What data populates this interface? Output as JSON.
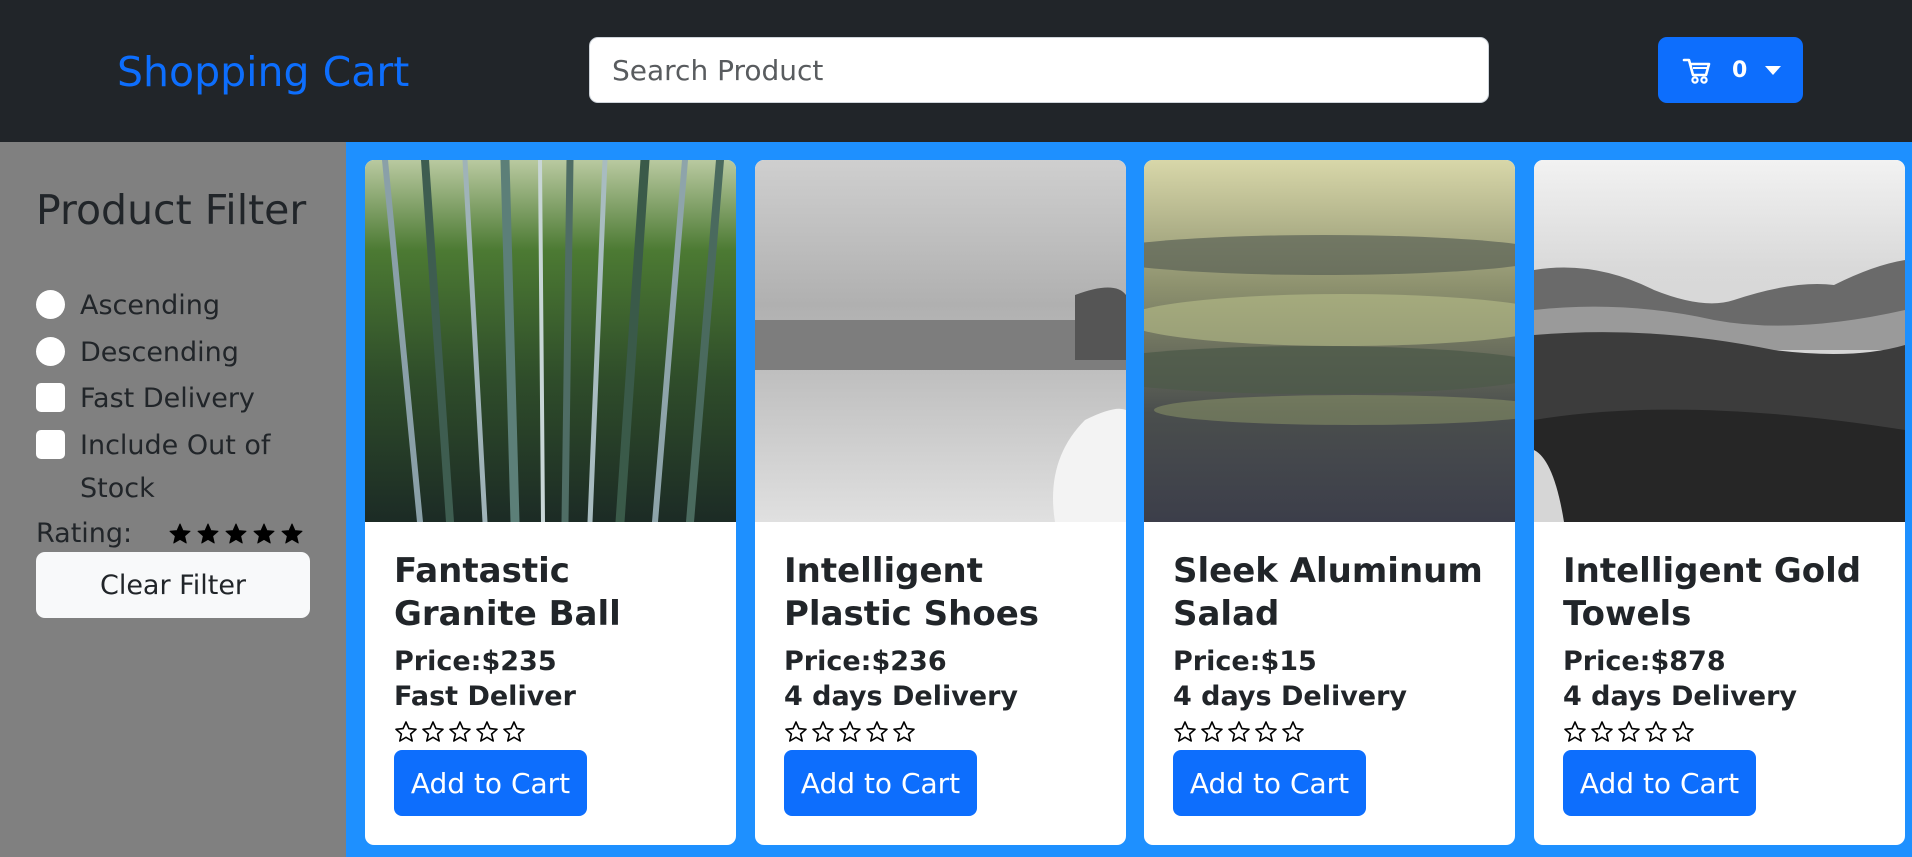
{
  "header": {
    "brand": "Shopping Cart",
    "search_placeholder": "Search Product",
    "search_value": "",
    "cart_count": "0",
    "brand_color": "#0d6efd",
    "navbar_color": "#212529"
  },
  "sidebar": {
    "title": "Product Filter",
    "options": [
      {
        "label": "Ascending",
        "type": "radio",
        "checked": false
      },
      {
        "label": "Descending",
        "type": "radio",
        "checked": false
      },
      {
        "label": "Fast Delivery",
        "type": "checkbox",
        "checked": false
      },
      {
        "label": "Include Out of Stock",
        "type": "checkbox",
        "checked": false
      }
    ],
    "rating_label": "Rating:",
    "rating_value": 5,
    "rating_max": 5,
    "clear_label": "Clear Filter"
  },
  "products": [
    {
      "name": "Fantastic Granite Ball",
      "price": "Price:$235",
      "delivery": "Fast Deliver",
      "rating": 0,
      "button": "Add to Cart",
      "image": "bamboo-forest"
    },
    {
      "name": "Intelligent Plastic Shoes",
      "price": "Price:$236",
      "delivery": "4 days Delivery",
      "rating": 0,
      "button": "Add to Cart",
      "image": "grayscale-seascape"
    },
    {
      "name": "Sleek Aluminum Salad",
      "price": "Price:$15",
      "delivery": "4 days Delivery",
      "rating": 0,
      "button": "Add to Cart",
      "image": "cloudy-sky"
    },
    {
      "name": "Intelligent Gold Towels",
      "price": "Price:$878",
      "delivery": "4 days Delivery",
      "rating": 0,
      "button": "Add to Cart",
      "image": "grayscale-landscape"
    }
  ],
  "colors": {
    "accent": "#0d6efd",
    "sidebar_bg": "#808080",
    "products_bg": "#1e90ff"
  }
}
